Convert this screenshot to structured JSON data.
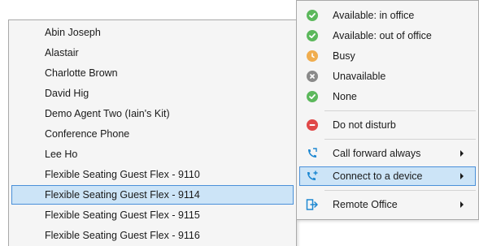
{
  "contacts": [
    "Abin Joseph",
    "Alastair",
    "Charlotte Brown",
    "David Hig",
    "Demo Agent Two (Iain's Kit)",
    "Conference Phone",
    "Lee Ho",
    "Flexible Seating Guest Flex - 9110",
    "Flexible Seating Guest Flex - 9114",
    "Flexible Seating Guest Flex - 9115",
    "Flexible Seating Guest Flex - 9116"
  ],
  "selected_contact_index": 8,
  "status_menu": {
    "items": [
      {
        "label": "Available: in office",
        "icon": "available-check-icon",
        "color": "#5cb85c"
      },
      {
        "label": "Available: out of office",
        "icon": "available-check-icon",
        "color": "#5cb85c"
      },
      {
        "label": "Busy",
        "icon": "busy-clock-icon",
        "color": "#f0ad4e"
      },
      {
        "label": "Unavailable",
        "icon": "unavailable-x-icon",
        "color": "#8a8a8a"
      },
      {
        "label": "None",
        "icon": "none-check-icon",
        "color": "#5cb85c"
      },
      {
        "label": "Do not disturb",
        "icon": "dnd-minus-icon",
        "color": "#e04848"
      },
      {
        "label": "Call forward always",
        "icon": "call-forward-icon",
        "color": "#1e88d2",
        "submenu": true
      },
      {
        "label": "Connect to a device",
        "icon": "connect-device-icon",
        "color": "#1e88d2",
        "submenu": true,
        "active": true
      },
      {
        "label": "Remote Office",
        "icon": "remote-office-icon",
        "color": "#1e88d2",
        "submenu": true
      }
    ]
  }
}
